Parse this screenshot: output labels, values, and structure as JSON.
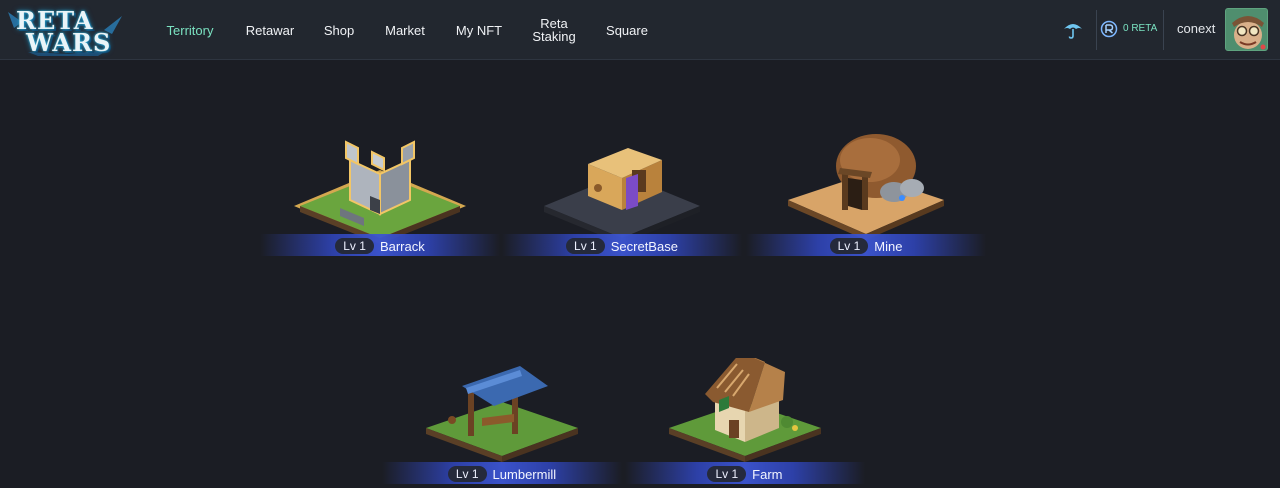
{
  "header": {
    "logo": {
      "line1": "RETA",
      "line2": "WARS"
    },
    "nav": [
      {
        "label": "Territory",
        "active": true
      },
      {
        "label": "Retawar",
        "active": false
      },
      {
        "label": "Shop",
        "active": false
      },
      {
        "label": "Market",
        "active": false
      },
      {
        "label": "My NFT",
        "active": false
      },
      {
        "label": "Reta\nStaking",
        "active": false
      },
      {
        "label": "Square",
        "active": false
      }
    ],
    "balance": "0 RETA",
    "username": "conext",
    "icons": {
      "umbrella": "umbrella-icon",
      "token": "reta-token-icon",
      "avatar": "avatar"
    }
  },
  "colors": {
    "accent": "#7be3c2",
    "background": "#1b1d24",
    "header": "#22272f",
    "label_glow": "#3c55d2"
  },
  "buildings": [
    {
      "name": "Barrack",
      "level": "Lv 1",
      "selected": true
    },
    {
      "name": "SecretBase",
      "level": "Lv 1",
      "selected": false
    },
    {
      "name": "Mine",
      "level": "Lv 1",
      "selected": false
    },
    {
      "name": "Lumbermill",
      "level": "Lv 1",
      "selected": false
    },
    {
      "name": "Farm",
      "level": "Lv 1",
      "selected": false
    }
  ]
}
